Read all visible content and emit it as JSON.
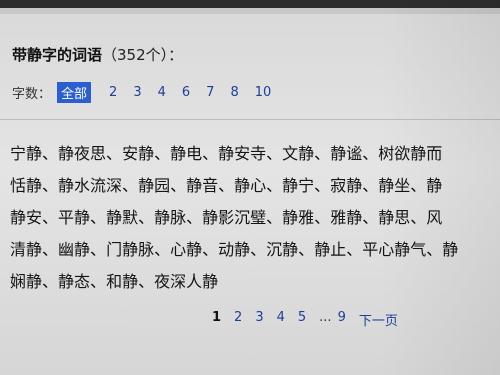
{
  "title": {
    "main": "带静字的词语",
    "count": "（352个）："
  },
  "filter": {
    "label": "字数：",
    "options": [
      "全部",
      "2",
      "3",
      "4",
      "6",
      "7",
      "8",
      "10"
    ],
    "active": "全部"
  },
  "word_rows": [
    [
      "宁静",
      "静夜思",
      "安静",
      "静电",
      "静安寺",
      "文静",
      "静谧",
      "树欲静而"
    ],
    [
      "恬静",
      "静水流深",
      "静园",
      "静音",
      "静心",
      "静宁",
      "寂静",
      "静坐",
      "静"
    ],
    [
      "静安",
      "平静",
      "静默",
      "静脉",
      "静影沉璧",
      "静雅",
      "雅静",
      "静思",
      "风"
    ],
    [
      "清静",
      "幽静",
      "门静脉",
      "心静",
      "动静",
      "沉静",
      "静止",
      "平心静气",
      "静"
    ],
    [
      "娴静",
      "静态",
      "和静",
      "夜深人静"
    ]
  ],
  "separator": "、",
  "pagination": {
    "pages": [
      "1",
      "2",
      "3",
      "4",
      "5"
    ],
    "ellipsis": "...",
    "last": "9",
    "next_label": "下一页",
    "current": "1"
  }
}
